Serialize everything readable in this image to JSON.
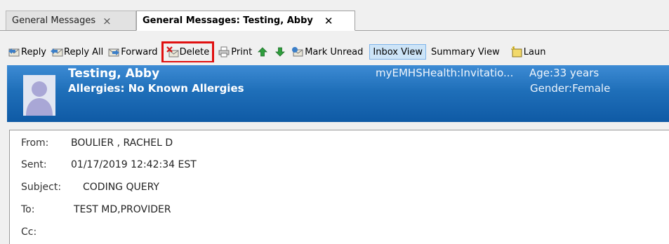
{
  "tabs": [
    {
      "label": "General Messages",
      "close": "×"
    },
    {
      "label": "General Messages: Testing, Abby",
      "close": "✕"
    }
  ],
  "toolbar": {
    "reply": "Reply",
    "reply_all": "Reply All",
    "forward": "Forward",
    "delete": "Delete",
    "print": "Print",
    "mark_unread": "Mark Unread",
    "inbox_view": "Inbox View",
    "summary_view": "Summary View",
    "launch": "Laun"
  },
  "patient": {
    "name": "Testing, Abby",
    "allergies": "Allergies: No Known Allergies",
    "portal": "myEMHSHealth:Invitatio...",
    "age": "Age:33 years",
    "gender": "Gender:Female"
  },
  "message": {
    "from_label": "From:",
    "from": "BOULIER , RACHEL D",
    "sent_label": "Sent:",
    "sent": "01/17/2019 12:42:34 EST",
    "subject_label": "Subject:",
    "subject": "CODING QUERY",
    "to_label": "To:",
    "to": "TEST MD,PROVIDER",
    "cc_label": "Cc:"
  },
  "colors": {
    "banner": "#1f6fb9",
    "highlight": "#e01010",
    "active_view": "#cde4f7"
  }
}
